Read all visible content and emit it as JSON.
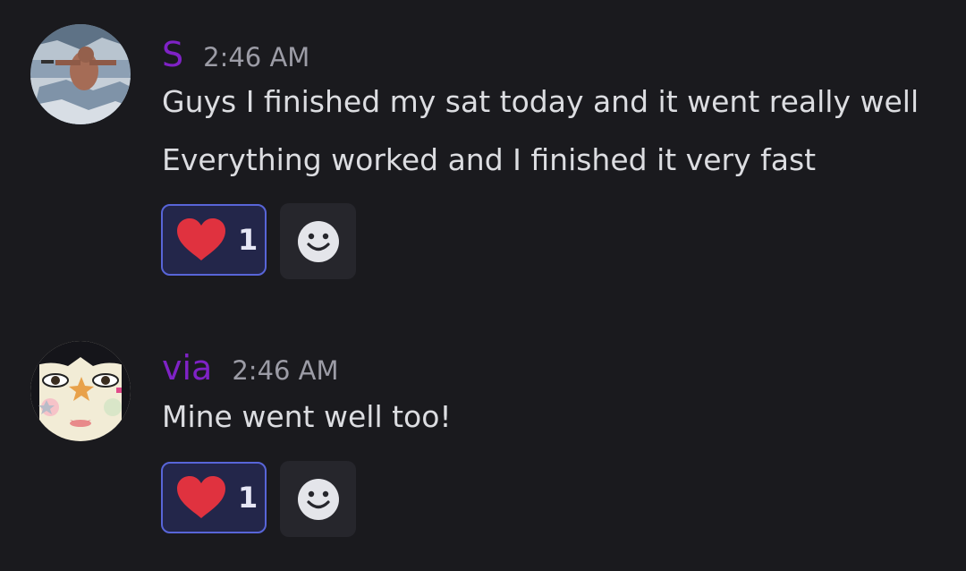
{
  "messages": [
    {
      "username": "S",
      "time": "2:46 AM",
      "lines": [
        "Guys I finished my sat today and it went really well",
        "Everything worked and I finished it very fast"
      ],
      "reaction": {
        "icon": "heart-icon",
        "count": "1"
      },
      "add_reaction_icon": "smiley-icon"
    },
    {
      "username": "via",
      "time": "2:46 AM",
      "lines": [
        "Mine went well too!"
      ],
      "reaction": {
        "icon": "heart-icon",
        "count": "1"
      },
      "add_reaction_icon": "smiley-icon"
    }
  ],
  "colors": {
    "background": "#1a1a1e",
    "username": "#7f22c6",
    "timestamp": "#9c9ca6",
    "message_text": "#dcdde1",
    "reaction_border": "#5865d8",
    "reaction_bg": "#23264a",
    "heart": "#e0323f"
  }
}
